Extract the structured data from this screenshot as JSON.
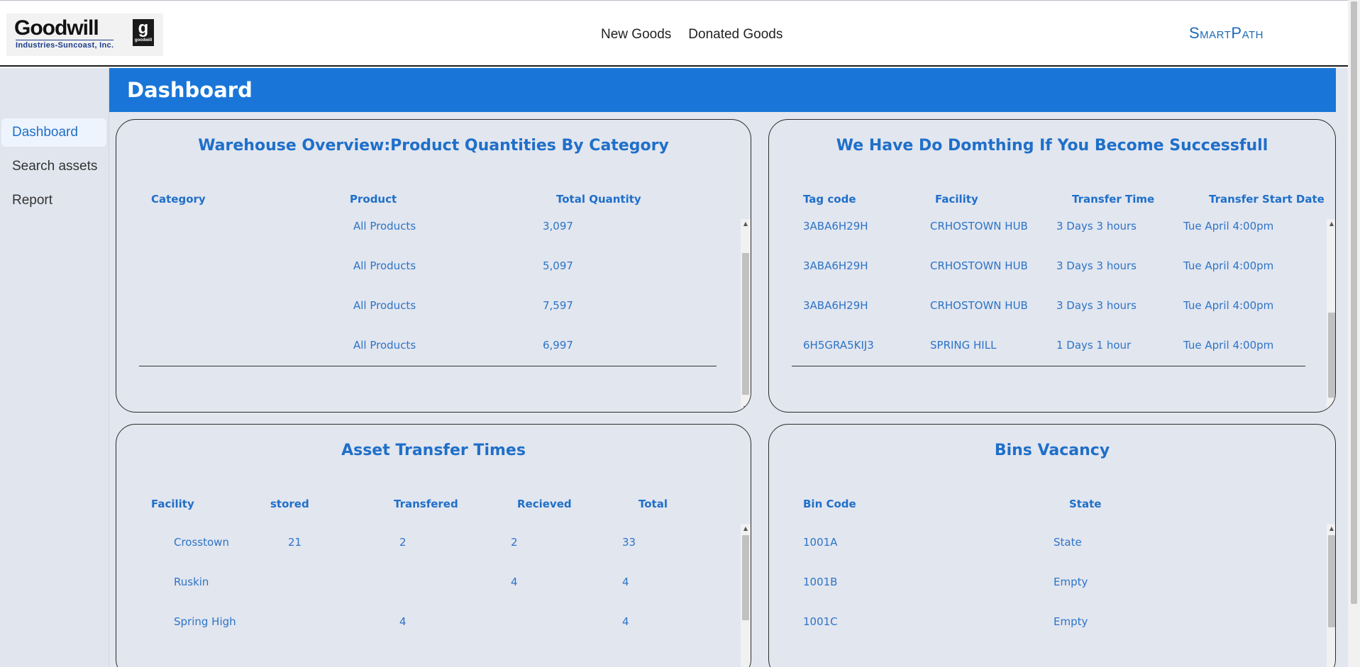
{
  "header": {
    "logo": {
      "name": "Goodwill",
      "subtitle": "Industries-Suncoast, Inc.",
      "badge": "g",
      "badge_small": "goodwill"
    },
    "nav": [
      "New Goods",
      "Donated Goods"
    ],
    "brand": "SmartPath"
  },
  "sidebar": {
    "items": [
      {
        "label": "Dashboard",
        "active": true
      },
      {
        "label": "Search assets",
        "active": false
      },
      {
        "label": "Report",
        "active": false
      }
    ]
  },
  "page": {
    "title": "Dashboard"
  },
  "panels": {
    "warehouse": {
      "title": "Warehouse Overview:Product Quantities By Category",
      "columns": [
        "Category",
        "Product",
        "Total Quantity"
      ],
      "rows": [
        {
          "category": "",
          "product": "All Products",
          "quantity": "3,097"
        },
        {
          "category": "",
          "product": "All Products",
          "quantity": "5,097"
        },
        {
          "category": "",
          "product": "All Products",
          "quantity": "7,597"
        },
        {
          "category": "",
          "product": "All Products",
          "quantity": "6,997"
        }
      ]
    },
    "transfers": {
      "title": "We Have Do Domthing If You Become Successfull",
      "columns": [
        "Tag code",
        "Facility",
        "Transfer Time",
        "Transfer Start Date"
      ],
      "rows": [
        {
          "tag": "3ABA6H29H",
          "facility": "CRHOSTOWN HUB",
          "time": "3 Days 3 hours",
          "date": "Tue April 4:00pm"
        },
        {
          "tag": "3ABA6H29H",
          "facility": "CRHOSTOWN HUB",
          "time": "3 Days 3 hours",
          "date": "Tue April 4:00pm"
        },
        {
          "tag": "3ABA6H29H",
          "facility": "CRHOSTOWN HUB",
          "time": "3 Days 3 hours",
          "date": "Tue April 4:00pm"
        },
        {
          "tag": "6H5GRA5KIJ3",
          "facility": "SPRING HILL",
          "time": "1 Days 1 hour",
          "date": "Tue April 4:00pm"
        }
      ]
    },
    "asset_times": {
      "title": "Asset Transfer Times",
      "columns": [
        "Facility",
        "stored",
        "Transfered",
        "Recieved",
        "Total"
      ],
      "rows": [
        {
          "facility": "Crosstown",
          "stored": "21",
          "transfered": "2",
          "recieved": "2",
          "total": "33"
        },
        {
          "facility": "Ruskin",
          "stored": "",
          "transfered": "",
          "recieved": "4",
          "total": "4"
        },
        {
          "facility": "Spring High",
          "stored": "",
          "transfered": "4",
          "recieved": "",
          "total": "4"
        }
      ]
    },
    "bins": {
      "title": "Bins Vacancy",
      "columns": [
        "Bin Code",
        "State"
      ],
      "rows": [
        {
          "code": "1001A",
          "state": "State"
        },
        {
          "code": "1001B",
          "state": "Empty"
        },
        {
          "code": "1001C",
          "state": "Empty"
        }
      ]
    }
  }
}
